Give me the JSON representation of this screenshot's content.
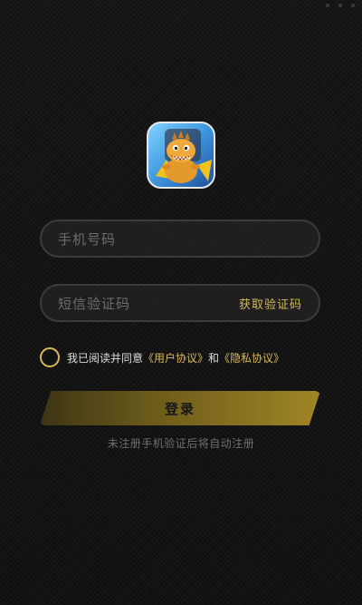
{
  "logo": {
    "icon": "app-mascot-icon"
  },
  "phone_field": {
    "placeholder": "手机号码"
  },
  "code_field": {
    "placeholder": "短信验证码",
    "get_code_label": "获取验证码"
  },
  "agreement": {
    "prefix": "我已阅读并同意",
    "user_agreement": "《用户协议》",
    "and": "和",
    "privacy_policy": "《隐私协议》",
    "checked": false
  },
  "login_button": {
    "label": "登录"
  },
  "hint": {
    "text": "未注册手机验证后将自动注册"
  },
  "colors": {
    "accent": "#d6b85a",
    "background": "#141414",
    "button_gradient_end": "#a08525"
  }
}
